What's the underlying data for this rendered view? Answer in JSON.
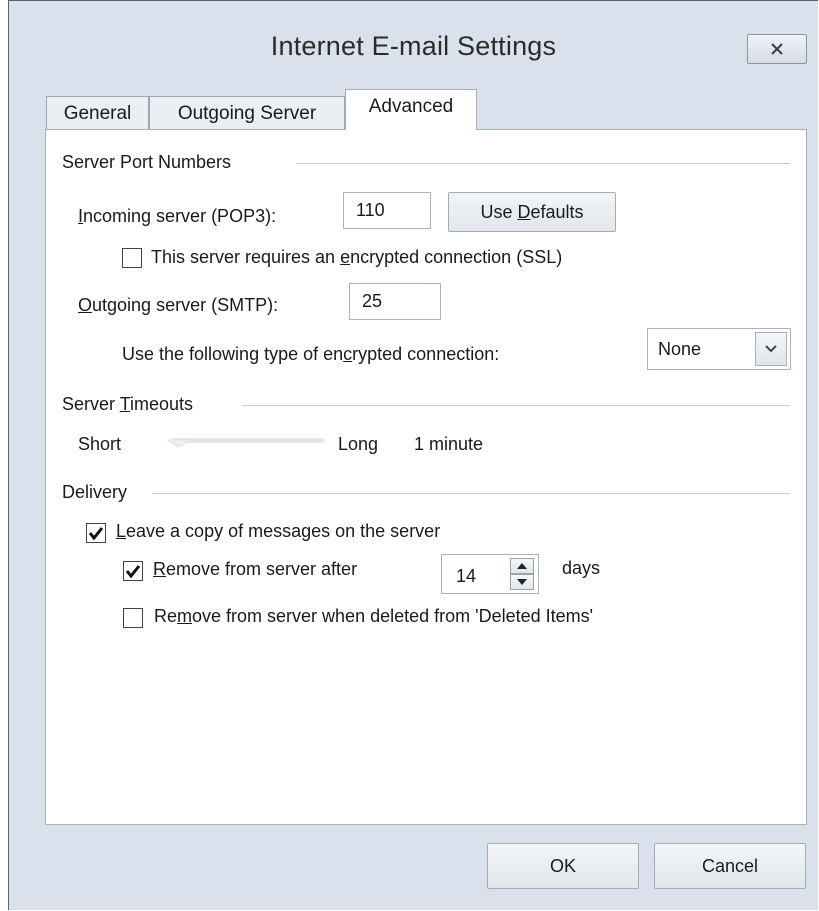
{
  "dialog": {
    "title": "Internet E-mail Settings",
    "close_label": "×"
  },
  "tabs": [
    {
      "label": "General",
      "selected": false
    },
    {
      "label": "Outgoing Server",
      "selected": false
    },
    {
      "label": "Advanced",
      "selected": true
    }
  ],
  "port_numbers": {
    "group_title": "Server Port Numbers",
    "incoming": {
      "label_u": "I",
      "label_rest": "ncoming server (POP3):",
      "value": "110"
    },
    "use_defaults": {
      "pre": "Use ",
      "u": "D",
      "post": "efaults"
    },
    "ssl": {
      "pre": "This server requires an ",
      "u": "e",
      "post": "ncrypted connection (SSL)",
      "checked": false
    },
    "outgoing": {
      "label_u": "O",
      "label_rest": "utgoing server (SMTP):",
      "value": "25"
    },
    "encryption": {
      "pre": "Use the following type of en",
      "u": "c",
      "post": "rypted connection:",
      "selected": "None"
    }
  },
  "timeouts": {
    "group_title_pre": "Server ",
    "group_title_u": "T",
    "group_title_post": "imeouts",
    "short_label": "Short",
    "long_label": "Long",
    "value_text": "1 minute",
    "slider_position": 0.0
  },
  "delivery": {
    "group_title": "Delivery",
    "leave_copy": {
      "u": "L",
      "rest": "eave a copy of messages on the server",
      "checked": true
    },
    "remove_after": {
      "u": "R",
      "rest": "emove from server after",
      "checked": true,
      "days_value": "14",
      "days_label": "days"
    },
    "remove_deleted": {
      "pre": "Re",
      "u": "m",
      "post": "ove from server when deleted from 'Deleted Items'",
      "checked": false
    }
  },
  "buttons": {
    "ok": "OK",
    "cancel": "Cancel"
  },
  "colors": {
    "window_bg": "#d9e2ec",
    "panel_bg": "#ffffff",
    "border": "#a8b2bd"
  }
}
